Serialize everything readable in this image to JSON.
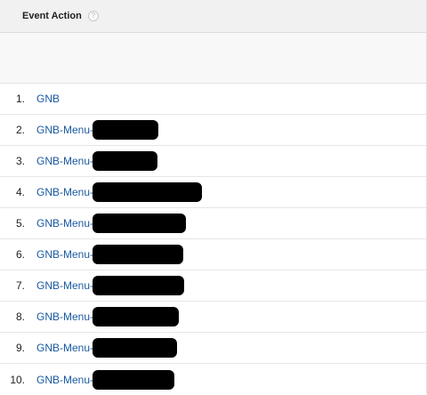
{
  "table": {
    "header": {
      "title": "Event Action",
      "help_glyph": "?"
    },
    "rows": [
      {
        "index": "1.",
        "label": "GNB",
        "redacted": false
      },
      {
        "index": "2.",
        "label": "GNB-Menu-",
        "redacted": true
      },
      {
        "index": "3.",
        "label": "GNB-Menu-",
        "redacted": true
      },
      {
        "index": "4.",
        "label": "GNB-Menu-",
        "redacted": true
      },
      {
        "index": "5.",
        "label": "GNB-Menu-",
        "redacted": true
      },
      {
        "index": "6.",
        "label": "GNB-Menu-",
        "redacted": true
      },
      {
        "index": "7.",
        "label": "GNB-Menu-",
        "redacted": true
      },
      {
        "index": "8.",
        "label": "GNB-Menu-",
        "redacted": true
      },
      {
        "index": "9.",
        "label": "GNB-Menu-",
        "redacted": true
      },
      {
        "index": "10.",
        "label": "GNB-Menu-",
        "redacted": true
      }
    ]
  },
  "colors": {
    "link": "#1a5aa0",
    "header_bg": "#f1f1f1",
    "redaction": "#000000"
  }
}
